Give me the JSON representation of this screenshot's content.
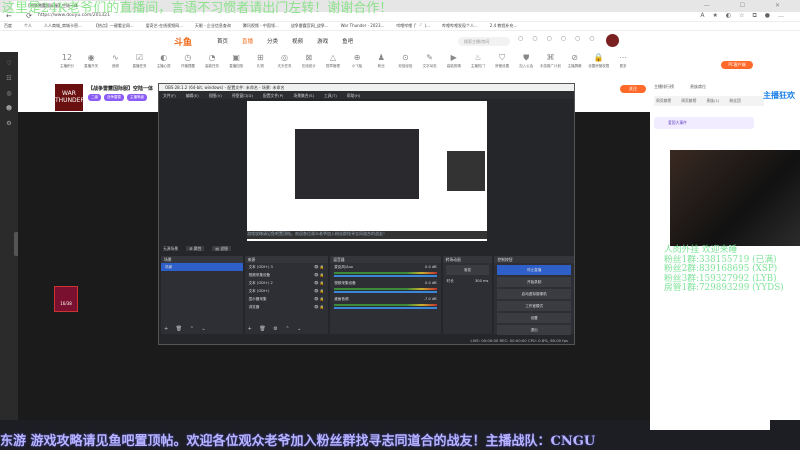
{
  "browser": {
    "tab_title": "【战争雷霆国际服】空陆一体",
    "url": "https://www.douyu.com/201321",
    "window_controls": "— ☐ ✕",
    "nav_icons": "← ⟳",
    "right_icons": "A★◐☆⧉●…"
  },
  "overlay_top": "这里是24K老爷们的直播间，言语不习惯者请出门左转！谢谢合作！",
  "bookmarks": [
    "百度",
    "个人",
    "人人商城_商城卡密...",
    "【热点】一键看全网...",
    "爱奇艺-在线视频网...",
    "天眼 - 企业信息查询",
    "腾讯视频 - 中国领...",
    "战争雷霆官网_战争...",
    "War Thunder - 2023...",
    "哔哩哔哩 (゜-゜)...",
    "哔哩哔哩发现个人...",
    "2.4 教程补充..."
  ],
  "header": {
    "logo": "斗鱼",
    "nav": [
      "首页",
      "直播",
      "分类",
      "视频",
      "游戏",
      "鱼吧"
    ],
    "search_placeholder": "搜索主播/房间",
    "icons": [
      "历史",
      "关注",
      "下载",
      "每日任务",
      "消息",
      "创作中心"
    ]
  },
  "categories": [
    {
      "icon": "12",
      "label": "主播积分"
    },
    {
      "icon": "◉",
      "label": "直播开关"
    },
    {
      "icon": "∿",
      "label": "音频"
    },
    {
      "icon": "☑",
      "label": "直播任务"
    },
    {
      "icon": "◐",
      "label": "主播心愿"
    },
    {
      "icon": "◷",
      "label": "开播提醒"
    },
    {
      "icon": "◔",
      "label": "高能任务"
    },
    {
      "icon": "▣",
      "label": "直播回放"
    },
    {
      "icon": "⊞",
      "label": "礼物"
    },
    {
      "icon": "◎",
      "label": "天天任务"
    },
    {
      "icon": "⊠",
      "label": "在线统计"
    },
    {
      "icon": "△",
      "label": "勋章管理"
    },
    {
      "icon": "⊕",
      "label": "小飞船"
    },
    {
      "icon": "♟",
      "label": "粉丝"
    },
    {
      "icon": "⊙",
      "label": "双倍经验"
    },
    {
      "icon": "✎",
      "label": "文字动态"
    },
    {
      "icon": "▶",
      "label": "高能剪辑"
    },
    {
      "icon": "♨",
      "label": "主播热门"
    },
    {
      "icon": "⛉",
      "label": "房管设置"
    },
    {
      "icon": "⛊",
      "label": "加入公会"
    },
    {
      "icon": "⌘",
      "label": "手游推广计划"
    },
    {
      "icon": "⊘",
      "label": "主播屏蔽"
    },
    {
      "icon": "🔒",
      "label": "设置房管权限"
    },
    {
      "icon": "⋯",
      "label": "更多"
    }
  ],
  "pc_button": "PC客户端",
  "sidebar": [
    "♡",
    "☷",
    "◎",
    "☻",
    "⚙"
  ],
  "stream": {
    "thumb_text": "WAR THUNDER",
    "title": "【战争雷霆国际服】空陆一体",
    "tags": [
      "二级",
      "战争雷霆",
      "主播等级"
    ],
    "follow": "关注"
  },
  "badge": "16/38",
  "obs": {
    "title": "OBS 28.1.2 (64-bit, windows) - 配置文件: 未命名 - 场景: 未命名",
    "menu": [
      "文件(F)",
      "编辑(E)",
      "视图(V)",
      "停靠窗口(D)",
      "配置文件(P)",
      "场景集合(S)",
      "工具(T)",
      "帮助(H)"
    ],
    "preview_ticker": "游戏攻略请见鱼吧置顶帖。欢迎各位观众老爷加入粉丝群找寻志同道合的战友！",
    "scene_bar": {
      "label": "无源场景",
      "props": "⚙ 属性",
      "filters": "▤ 滤镜"
    },
    "scenes": {
      "title": "场景",
      "items": [
        "场景"
      ]
    },
    "sources": {
      "title": "来源",
      "items": [
        "文本 (GDI+) 3",
        "视频采集设备",
        "文本 (GDI+) 2",
        "文本 (GDI+)",
        "显示器采集",
        "浏览器"
      ]
    },
    "mixer": {
      "title": "混音器",
      "channels": [
        {
          "name": "麦克风/Aux",
          "db": "0.0 dB"
        },
        {
          "name": "视频采集设备",
          "db": "0.0 dB"
        },
        {
          "name": "桌面音频",
          "db": "-7.0 dB"
        }
      ]
    },
    "transitions": {
      "title": "转场动画",
      "type": "渐变",
      "duration_label": "时长",
      "duration": "300 ms"
    },
    "controls": {
      "title": "控制按钮",
      "buttons": [
        "停止直播",
        "开始录制",
        "启动虚拟摄像机",
        "工作室模式",
        "设置",
        "退出"
      ]
    },
    "status": "LIVE: 00:00:00   REC: 00:00:00   CPU: 0.8%, 60.00 fps"
  },
  "right_panel": {
    "tabs": [
      "主播排行榜",
      "贵族席位"
    ],
    "subtabs": [
      "周贡献榜",
      "周贡献榜",
      "贵族(1)",
      "粉丝团"
    ],
    "notice": "爱国大事件",
    "promo": "主播狂欢"
  },
  "green_text": [
    "人肉外挂 欢迎来睡",
    "粉丝1群:338155719 (已满)",
    "粉丝2群:839168695 (XSP)",
    "粉丝3群:159327992 (LYB)",
    "房管1群:729893299 (YYDS)"
  ],
  "ticker": "东游 游戏攻略请见鱼吧置顶帖。欢迎各位观众老爷加入粉丝群找寻志同道合的战友！主播战队：CNGU"
}
